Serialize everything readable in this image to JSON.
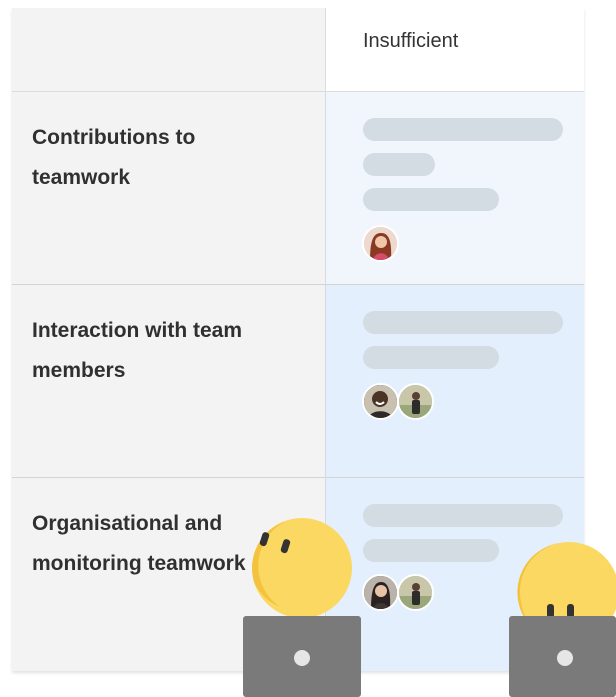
{
  "header": {
    "level_label": "Insufficient"
  },
  "criteria": [
    {
      "label": "Contributions to teamwork"
    },
    {
      "label": "Interaction with team members"
    },
    {
      "label": "Organisational and monitoring teamwork"
    }
  ],
  "avatars": {
    "row1": [
      "woman-red-hair-avatar"
    ],
    "row2": [
      "man-smiling-avatar",
      "person-outdoors-avatar"
    ],
    "row3": [
      "woman-dark-hair-avatar",
      "person-outdoors-avatar"
    ]
  },
  "colors": {
    "criterion_bg": "#f3f3f3",
    "level_row1_bg": "#f1f6fd",
    "level_row2_bg": "#e3effd",
    "level_row3_bg": "#e3effd",
    "placeholder_bar": "#d3dbe3",
    "mascot_yellow": "#fbd862",
    "laptop_gray": "#7a7a7a"
  }
}
